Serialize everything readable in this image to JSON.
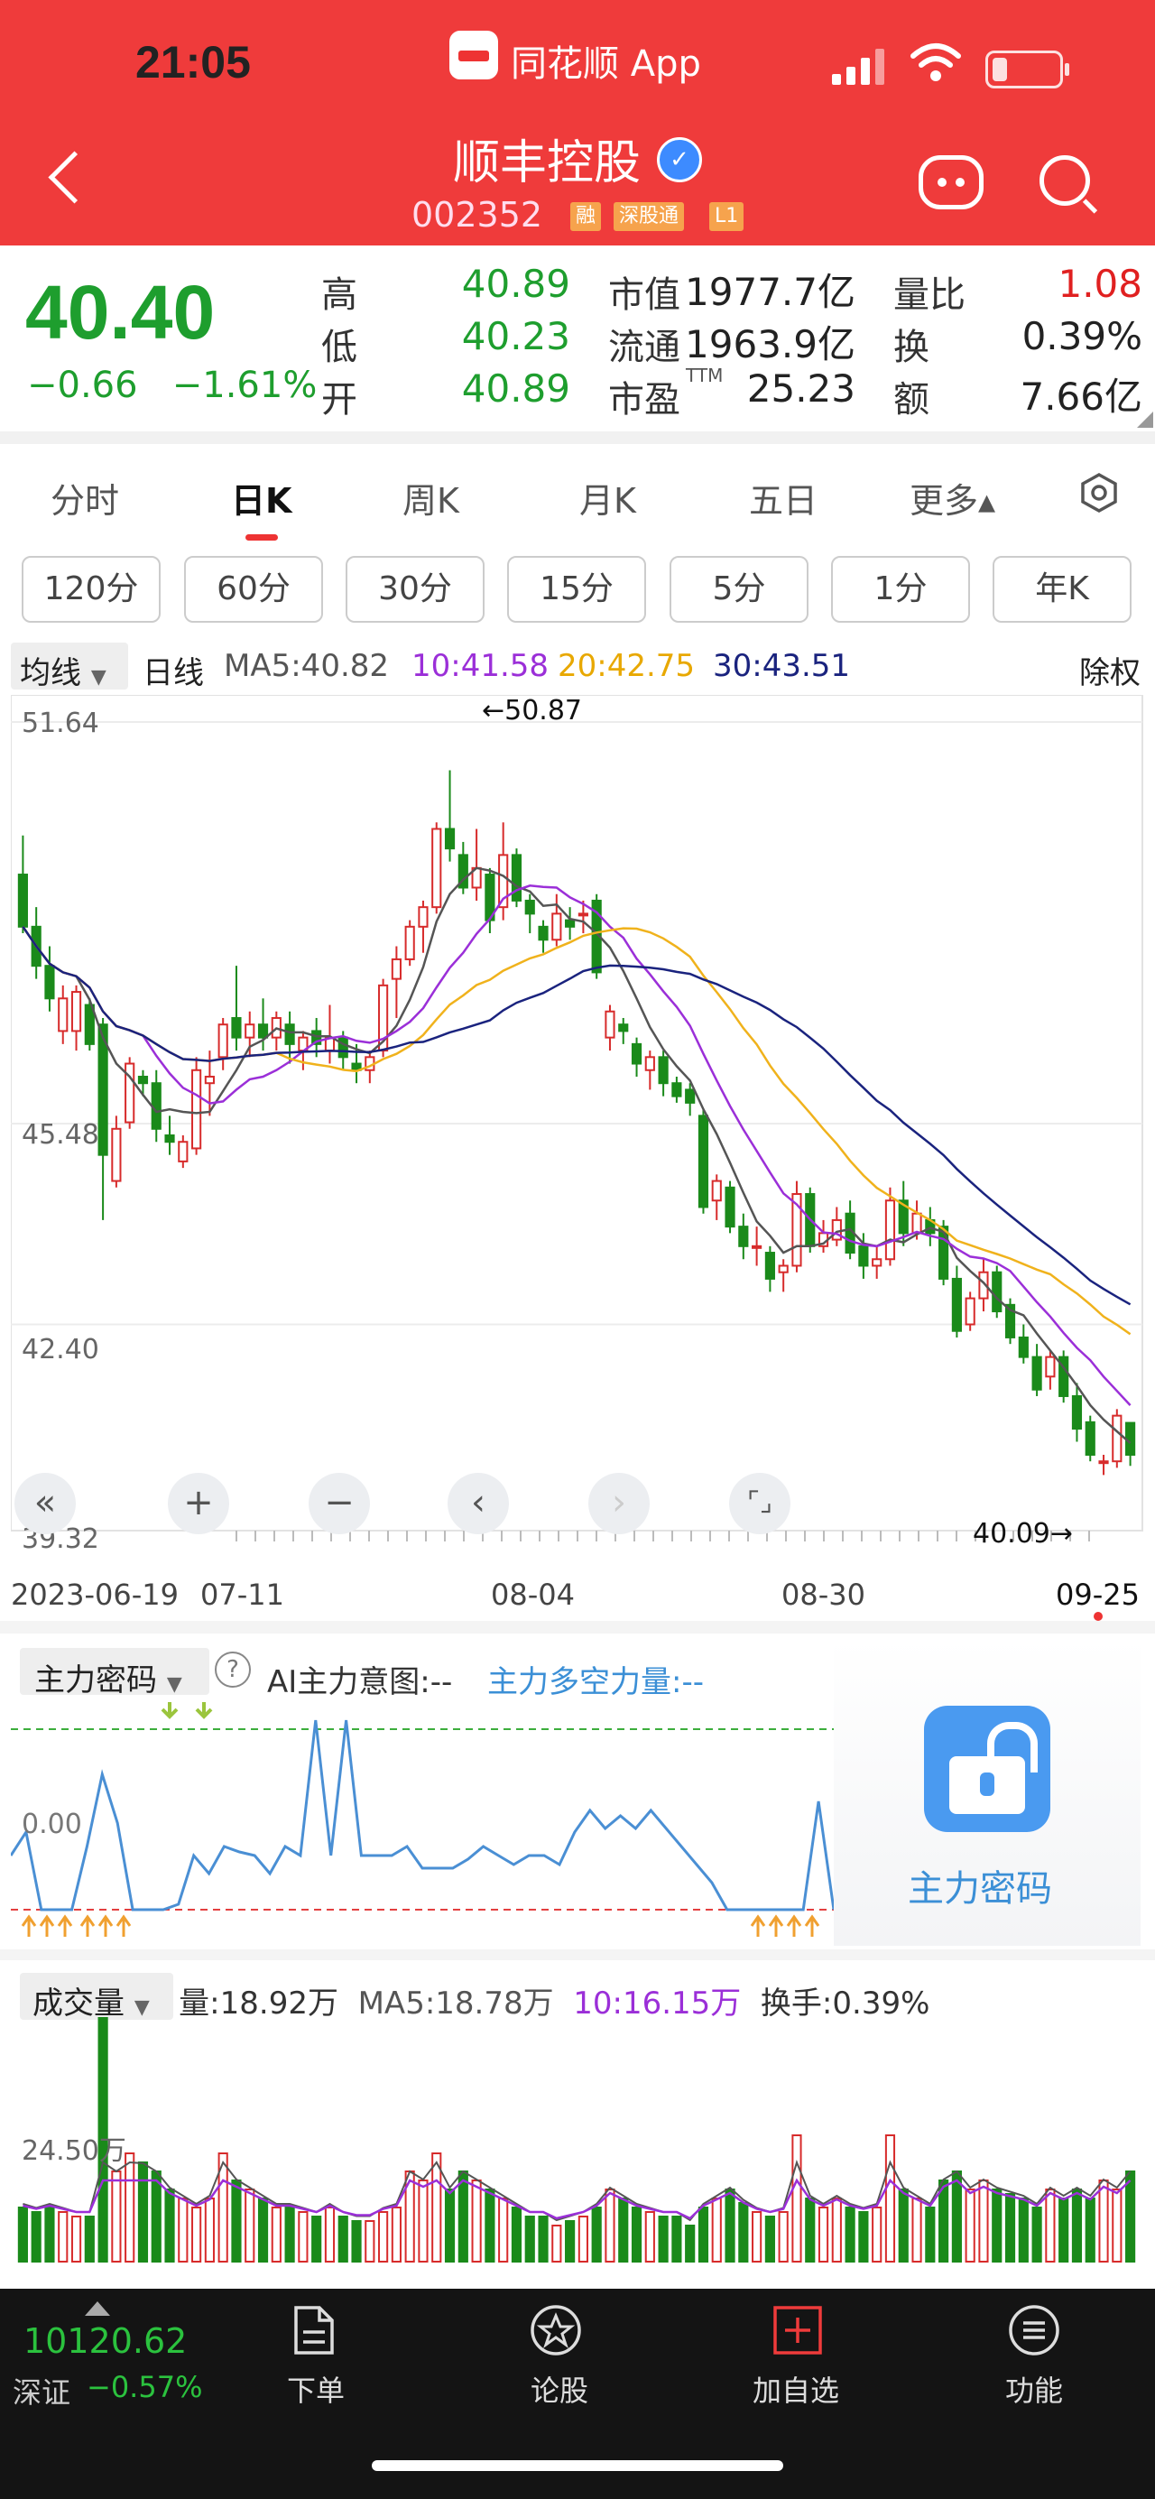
{
  "status_bar": {
    "time": "21:05",
    "app_name": "同花顺 App"
  },
  "header": {
    "title": "顺丰控股",
    "code": "002352",
    "tags": [
      "融",
      "深股通",
      "L1"
    ],
    "icons": [
      "back-icon",
      "verified-icon",
      "robot-icon",
      "search-icon"
    ]
  },
  "quote": {
    "price": "40.40",
    "change": "−0.66",
    "change_pct": "−1.61%",
    "high_label": "高",
    "high": "40.89",
    "low_label": "低",
    "low": "40.23",
    "open_label": "开",
    "open": "40.89",
    "mcap_label": "市值",
    "mcap": "1977.7亿",
    "float_label": "流通",
    "float": "1963.9亿",
    "pe_label": "市盈",
    "pe_sup": "TTM",
    "pe": "25.23",
    "vol_ratio_label": "量比",
    "vol_ratio": "1.08",
    "turnover_label": "换",
    "turnover": "0.39%",
    "amount_label": "额",
    "amount": "7.66亿"
  },
  "tabs": [
    "分时",
    "日K",
    "周K",
    "月K",
    "五日",
    "更多▴"
  ],
  "periods": [
    "120分",
    "60分",
    "30分",
    "15分",
    "5分",
    "1分",
    "年K"
  ],
  "ma_bar": {
    "selector": "均线",
    "period": "日线",
    "ma5": "MA5:40.82",
    "ma10": "10:41.58",
    "ma20": "20:42.75",
    "ma30": "30:43.51",
    "adjust": "除权"
  },
  "colors": {
    "up": "#d72b2b",
    "down": "#1a8a1a",
    "ma5": "#555555",
    "ma10": "#9b2fd8",
    "ma20": "#f0b21c",
    "ma30": "#1a237e"
  },
  "chart_data": {
    "type": "candlestick",
    "y_ticks": [
      "51.64",
      "45.48",
      "42.40",
      "39.32"
    ],
    "ylim": [
      39.32,
      51.64
    ],
    "x_labels": [
      "2023-06-19",
      "07-11",
      "08-04",
      "08-30",
      "09-25"
    ],
    "max_label": "←50.87",
    "min_label": "40.09→",
    "candles": [
      [
        49.3,
        48.5,
        49.9,
        48.4
      ],
      [
        48.5,
        47.9,
        48.8,
        47.7
      ],
      [
        47.9,
        47.4,
        48.2,
        47.2
      ],
      [
        46.9,
        47.4,
        47.6,
        46.7
      ],
      [
        46.9,
        47.5,
        47.6,
        46.6
      ],
      [
        47.3,
        46.7,
        47.4,
        46.6
      ],
      [
        47.0,
        45.0,
        47.1,
        44.0
      ],
      [
        44.6,
        45.4,
        45.6,
        44.5
      ],
      [
        45.5,
        46.4,
        46.5,
        45.4
      ],
      [
        46.2,
        46.1,
        46.3,
        45.9
      ],
      [
        46.1,
        45.4,
        46.3,
        45.2
      ],
      [
        45.3,
        45.2,
        45.6,
        45.0
      ],
      [
        44.9,
        45.2,
        45.3,
        44.8
      ],
      [
        45.1,
        46.3,
        46.5,
        45.0
      ],
      [
        46.1,
        46.2,
        46.6,
        45.6
      ],
      [
        46.5,
        47.0,
        47.1,
        46.3
      ],
      [
        47.1,
        46.8,
        47.9,
        46.6
      ],
      [
        46.8,
        47.0,
        47.2,
        46.5
      ],
      [
        47.0,
        46.8,
        47.4,
        46.6
      ],
      [
        46.8,
        47.1,
        47.2,
        46.6
      ],
      [
        47.0,
        46.7,
        47.2,
        46.4
      ],
      [
        46.6,
        46.8,
        46.9,
        46.3
      ],
      [
        46.9,
        46.7,
        47.1,
        46.5
      ],
      [
        46.6,
        46.8,
        47.3,
        46.4
      ],
      [
        46.8,
        46.5,
        46.9,
        46.3
      ],
      [
        46.4,
        46.3,
        46.7,
        46.1
      ],
      [
        46.3,
        46.5,
        46.6,
        46.1
      ],
      [
        46.6,
        47.6,
        47.7,
        46.5
      ],
      [
        47.7,
        48.0,
        48.2,
        47.1
      ],
      [
        48.0,
        48.5,
        48.6,
        47.9
      ],
      [
        48.5,
        48.8,
        48.9,
        48.1
      ],
      [
        48.8,
        50.0,
        50.1,
        48.7
      ],
      [
        50.0,
        49.7,
        50.9,
        49.5
      ],
      [
        49.6,
        49.1,
        49.8,
        49.0
      ],
      [
        49.1,
        49.4,
        50.0,
        48.9
      ],
      [
        49.3,
        48.6,
        49.4,
        48.4
      ],
      [
        48.8,
        49.6,
        50.1,
        48.6
      ],
      [
        49.6,
        48.9,
        49.7,
        48.8
      ],
      [
        48.9,
        48.7,
        49.0,
        48.4
      ],
      [
        48.5,
        48.3,
        48.6,
        48.1
      ],
      [
        48.3,
        48.7,
        49.0,
        48.2
      ],
      [
        48.6,
        48.5,
        48.8,
        48.3
      ],
      [
        48.7,
        48.7,
        48.9,
        48.4
      ],
      [
        48.9,
        47.8,
        49.0,
        47.7
      ],
      [
        46.8,
        47.2,
        47.3,
        46.6
      ],
      [
        47.0,
        46.9,
        47.1,
        46.7
      ],
      [
        46.7,
        46.4,
        46.8,
        46.2
      ],
      [
        46.3,
        46.5,
        46.6,
        46.0
      ],
      [
        46.5,
        46.1,
        46.6,
        45.9
      ],
      [
        46.1,
        45.9,
        46.2,
        45.8
      ],
      [
        46.0,
        45.8,
        46.1,
        45.6
      ],
      [
        45.6,
        44.2,
        45.7,
        44.1
      ],
      [
        44.3,
        44.6,
        44.7,
        44.0
      ],
      [
        44.5,
        43.9,
        44.6,
        43.8
      ],
      [
        43.9,
        43.6,
        44.1,
        43.4
      ],
      [
        43.6,
        43.6,
        43.9,
        43.3
      ],
      [
        43.5,
        43.1,
        43.6,
        42.9
      ],
      [
        43.2,
        43.3,
        43.4,
        42.9
      ],
      [
        43.3,
        44.4,
        44.6,
        43.2
      ],
      [
        44.4,
        43.6,
        44.5,
        43.5
      ],
      [
        43.6,
        43.8,
        44.0,
        43.5
      ],
      [
        43.7,
        44.0,
        44.2,
        43.6
      ],
      [
        44.1,
        43.5,
        44.3,
        43.4
      ],
      [
        43.6,
        43.3,
        43.8,
        43.1
      ],
      [
        43.3,
        43.4,
        43.6,
        43.1
      ],
      [
        43.4,
        44.3,
        44.5,
        43.3
      ],
      [
        44.3,
        43.8,
        44.6,
        43.6
      ],
      [
        43.8,
        44.1,
        44.3,
        43.7
      ],
      [
        44.0,
        43.8,
        44.2,
        43.6
      ],
      [
        43.9,
        43.1,
        44.0,
        43.0
      ],
      [
        43.1,
        42.3,
        43.3,
        42.2
      ],
      [
        42.4,
        42.8,
        42.9,
        42.3
      ],
      [
        42.8,
        43.2,
        43.4,
        42.6
      ],
      [
        43.2,
        42.6,
        43.3,
        42.5
      ],
      [
        42.7,
        42.2,
        42.8,
        42.1
      ],
      [
        42.2,
        41.9,
        42.4,
        41.8
      ],
      [
        41.9,
        41.4,
        42.1,
        41.3
      ],
      [
        41.6,
        41.9,
        42.0,
        41.4
      ],
      [
        41.9,
        41.3,
        42.0,
        41.2
      ],
      [
        41.3,
        40.8,
        41.5,
        40.6
      ],
      [
        40.9,
        40.4,
        41.0,
        40.3
      ],
      [
        40.3,
        40.3,
        40.4,
        40.09
      ],
      [
        40.3,
        41.0,
        41.1,
        40.2
      ],
      [
        40.89,
        40.4,
        40.89,
        40.23
      ]
    ]
  },
  "controls": [
    "rewind-icon",
    "zoom-in-icon",
    "zoom-out-icon",
    "prev-icon",
    "next-icon",
    "fullscreen-icon"
  ],
  "indicator": {
    "selector": "主力密码",
    "ai": "AI主力意图:--",
    "force": "主力多空力量:--",
    "zero": "0.00",
    "lock_label": "主力密码"
  },
  "volume": {
    "selector": "成交量",
    "vol": "量:18.92万",
    "ma5": "MA5:18.78万",
    "ma10": "10:16.15万",
    "turnover": "换手:0.39%",
    "y_tick": "24.50万"
  },
  "bottom_nav": {
    "index_value": "10120.62",
    "index_name": "深证",
    "index_change": "−0.57%",
    "items": [
      "下单",
      "论股",
      "加自选",
      "功能"
    ]
  }
}
